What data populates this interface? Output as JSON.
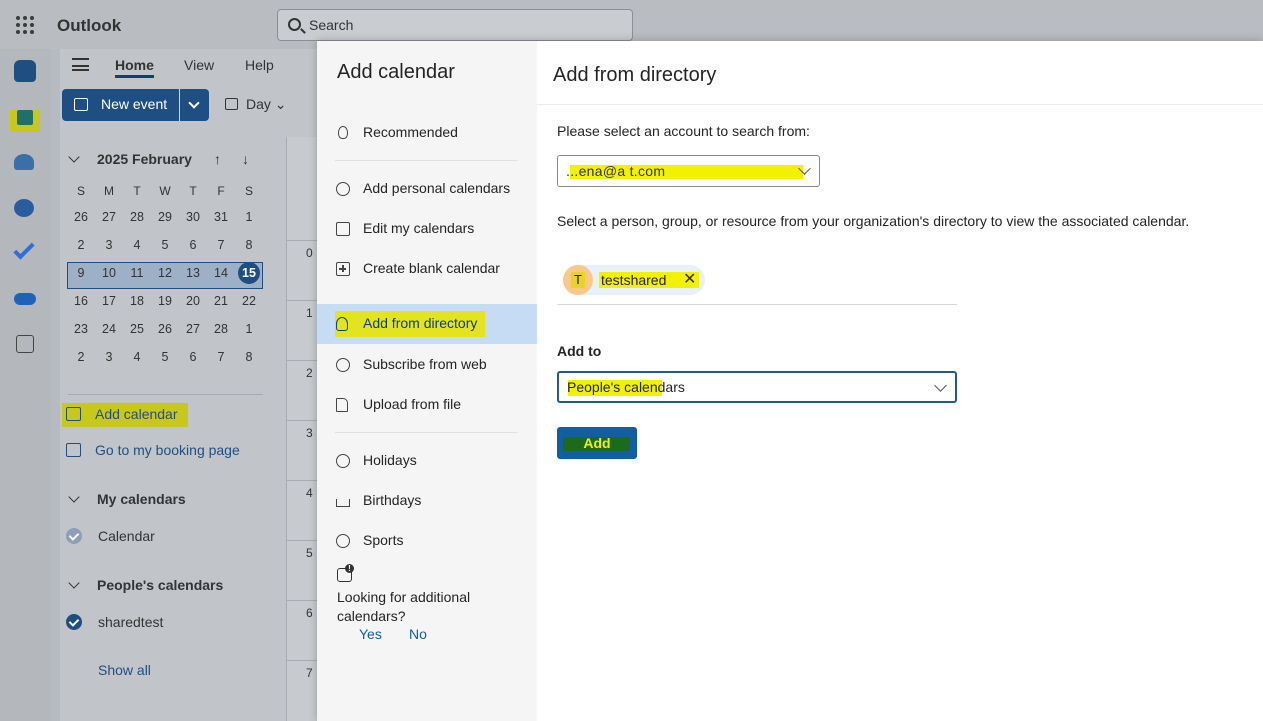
{
  "app": {
    "name": "Outlook",
    "search_placeholder": "Search"
  },
  "ribbon": {
    "tabs": [
      "Home",
      "View",
      "Help"
    ],
    "new_event": "New event",
    "view_mode": "Day"
  },
  "mini_calendar": {
    "month_label": "2025 February",
    "weekday_headers": [
      "S",
      "M",
      "T",
      "W",
      "T",
      "F",
      "S"
    ],
    "weeks": [
      [
        "26",
        "27",
        "28",
        "29",
        "30",
        "31",
        "1"
      ],
      [
        "2",
        "3",
        "4",
        "5",
        "6",
        "7",
        "8"
      ],
      [
        "9",
        "10",
        "11",
        "12",
        "13",
        "14",
        "15"
      ],
      [
        "16",
        "17",
        "18",
        "19",
        "20",
        "21",
        "22"
      ],
      [
        "23",
        "24",
        "25",
        "26",
        "27",
        "28",
        "1"
      ],
      [
        "2",
        "3",
        "4",
        "5",
        "6",
        "7",
        "8"
      ]
    ],
    "selected_week_index": 2,
    "today": "15"
  },
  "left_nav": {
    "add_calendar": "Add calendar",
    "booking_page": "Go to my booking page",
    "groups": [
      {
        "name": "My calendars",
        "items": [
          "Calendar"
        ]
      },
      {
        "name": "People's calendars",
        "items": [
          "sharedtest"
        ]
      }
    ],
    "show_all": "Show all"
  },
  "hours": [
    "0",
    "1",
    "2",
    "3",
    "4",
    "5",
    "6",
    "7"
  ],
  "dialog": {
    "title": "Add calendar",
    "nav": [
      {
        "label": "Recommended",
        "icon": "lightbulb-icon"
      },
      {
        "label": "Add personal calendars",
        "icon": "at-icon"
      },
      {
        "label": "Edit my calendars",
        "icon": "edit-calendar-icon"
      },
      {
        "label": "Create blank calendar",
        "icon": "calendar-add-icon"
      },
      {
        "label": "Add from directory",
        "icon": "people-search-icon",
        "active": true
      },
      {
        "label": "Subscribe from web",
        "icon": "web-icon"
      },
      {
        "label": "Upload from file",
        "icon": "document-icon"
      },
      {
        "label": "Holidays",
        "icon": "globe-icon"
      },
      {
        "label": "Birthdays",
        "icon": "cake-icon"
      },
      {
        "label": "Sports",
        "icon": "sports-icon"
      }
    ],
    "feedback": {
      "question": "Looking for additional calendars?",
      "yes": "Yes",
      "no": "No"
    },
    "panel": {
      "title": "Add from directory",
      "account_label": "Please select an account to search from:",
      "account_value": "...ena@a                                      t.com",
      "directory_hint": "Select a person, group, or resource from your organization's directory to view the associated calendar.",
      "selected_person": {
        "initial": "T",
        "name": "testshared"
      },
      "add_to_label": "Add to",
      "add_to_value": "People's calendars",
      "add_button": "Add"
    }
  },
  "colors": {
    "accent": "#115ea3",
    "highlight": "#f2f200",
    "nav_active": "#c6dcf5"
  }
}
